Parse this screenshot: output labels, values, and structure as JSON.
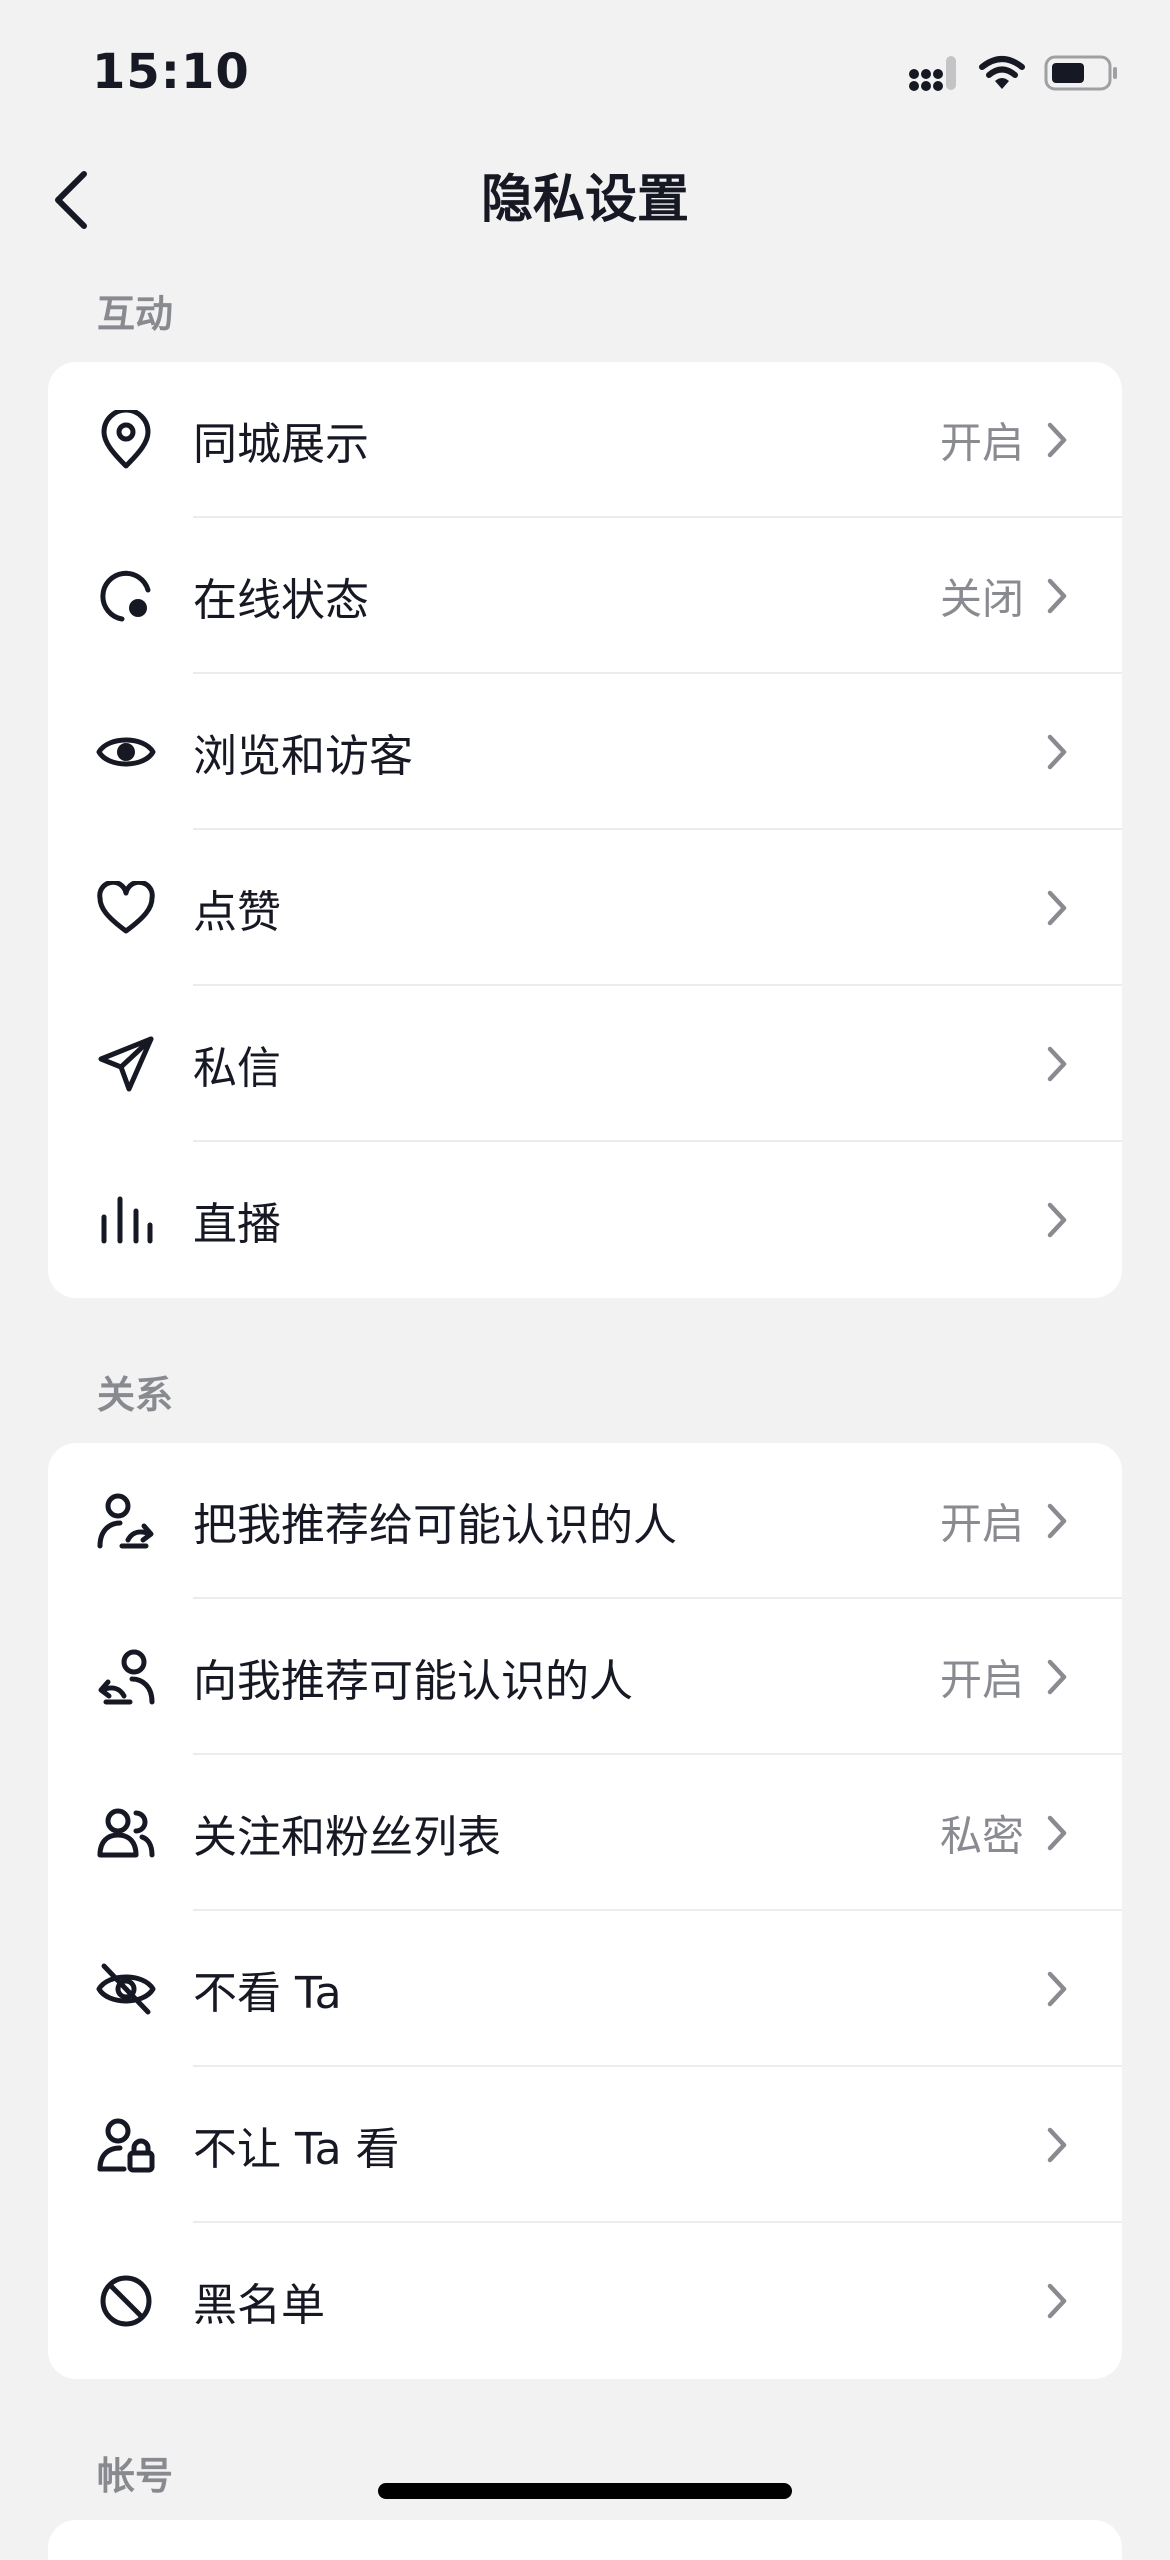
{
  "status_bar": {
    "time": "15:10"
  },
  "nav": {
    "title": "隐私设置"
  },
  "sections": [
    {
      "header": "互动",
      "items": [
        {
          "label": "同城展示",
          "value": "开启",
          "icon": "location-pin-icon"
        },
        {
          "label": "在线状态",
          "value": "关闭",
          "icon": "online-status-icon"
        },
        {
          "label": "浏览和访客",
          "value": "",
          "icon": "eye-icon"
        },
        {
          "label": "点赞",
          "value": "",
          "icon": "heart-icon"
        },
        {
          "label": "私信",
          "value": "",
          "icon": "paper-plane-icon"
        },
        {
          "label": "直播",
          "value": "",
          "icon": "live-bars-icon"
        }
      ]
    },
    {
      "header": "关系",
      "items": [
        {
          "label": "把我推荐给可能认识的人",
          "value": "开启",
          "icon": "user-share-icon"
        },
        {
          "label": "向我推荐可能认识的人",
          "value": "开启",
          "icon": "user-recommend-icon"
        },
        {
          "label": "关注和粉丝列表",
          "value": "私密",
          "icon": "users-icon"
        },
        {
          "label": "不看 Ta",
          "value": "",
          "icon": "eye-off-icon"
        },
        {
          "label": "不让 Ta 看",
          "value": "",
          "icon": "user-lock-icon"
        },
        {
          "label": "黑名单",
          "value": "",
          "icon": "block-icon"
        }
      ]
    },
    {
      "header": "帐号",
      "items": []
    }
  ]
}
